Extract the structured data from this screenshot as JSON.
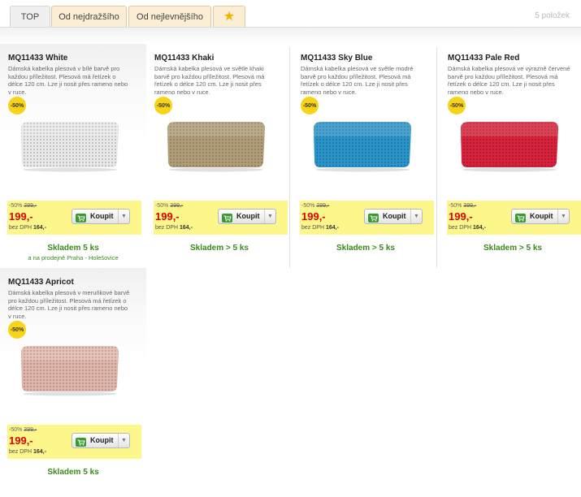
{
  "tabs": [
    {
      "label": "TOP",
      "active": true
    },
    {
      "label": "Od nejdražšího",
      "active": false
    },
    {
      "label": "Od nejlevnějšího",
      "active": false
    },
    {
      "label": "",
      "icon": "star-icon",
      "active": false
    }
  ],
  "item_count": "5 položek",
  "buy_label": "Koupit",
  "products": [
    {
      "name": "MQ11433 White",
      "description": "Dámská kabelka plesová v bílé barvě pro každou příležitost. Plesová má řetízek o délce 120 cm. Lze ji nosit přes rameno nebo v ruce.",
      "badge": "-50%",
      "old_price_prefix": "-50%",
      "old_price": "399,-",
      "price": "199,-",
      "vat_label": "bez DPH",
      "vat_value": "164,-",
      "stock": "Skladem 5 ks",
      "store_note": "a na prodejně Praha - Holešovice",
      "color": "#e8e8e8"
    },
    {
      "name": "MQ11433 Khaki",
      "description": "Dámská kabelka plesová ve světle khaki barvě pro každou příležitost. Plesová má řetízek o délce 120 cm. Lze ji nosit přes rameno nebo v ruce.",
      "badge": "-50%",
      "old_price_prefix": "-50%",
      "old_price": "399,-",
      "price": "199,-",
      "vat_label": "bez DPH",
      "vat_value": "164,-",
      "stock": "Skladem > 5 ks",
      "store_note": "",
      "color": "#b09c77"
    },
    {
      "name": "MQ11433 Sky Blue",
      "description": "Dámská kabelka plesová ve světle modré barvě pro každou příležitost. Plesová má řetízek o délce 120 cm. Lze ji nosit přes rameno nebo v ruce.",
      "badge": "-50%",
      "old_price_prefix": "-50%",
      "old_price": "399,-",
      "price": "199,-",
      "vat_label": "bez DPH",
      "vat_value": "164,-",
      "stock": "Skladem > 5 ks",
      "store_note": "",
      "color": "#2a93c9"
    },
    {
      "name": "MQ11433 Pale Red",
      "description": "Dámská kabelka plesová ve výrazně červené barvě pro každou příležitost. Plesová má řetízek o délce 120 cm. Lze ji nosit přes rameno nebo v ruce.",
      "badge": "-50%",
      "old_price_prefix": "-50%",
      "old_price": "399,-",
      "price": "199,-",
      "vat_label": "bez DPH",
      "vat_value": "164,-",
      "stock": "Skladem > 5 ks",
      "store_note": "",
      "color": "#d5223a"
    },
    {
      "name": "MQ11433 Apricot",
      "description": "Dámská kabelka plesová v meruňkové barvě pro každou příležitost. Plesová má řetízek o délce 120 cm. Lze ji nosit přes rameno nebo v ruce.",
      "badge": "-50%",
      "old_price_prefix": "-50%",
      "old_price": "399,-",
      "price": "199,-",
      "vat_label": "bez DPH",
      "vat_value": "164,-",
      "stock": "Skladem 5 ks",
      "store_note": "",
      "color": "#e0b6ab"
    }
  ]
}
